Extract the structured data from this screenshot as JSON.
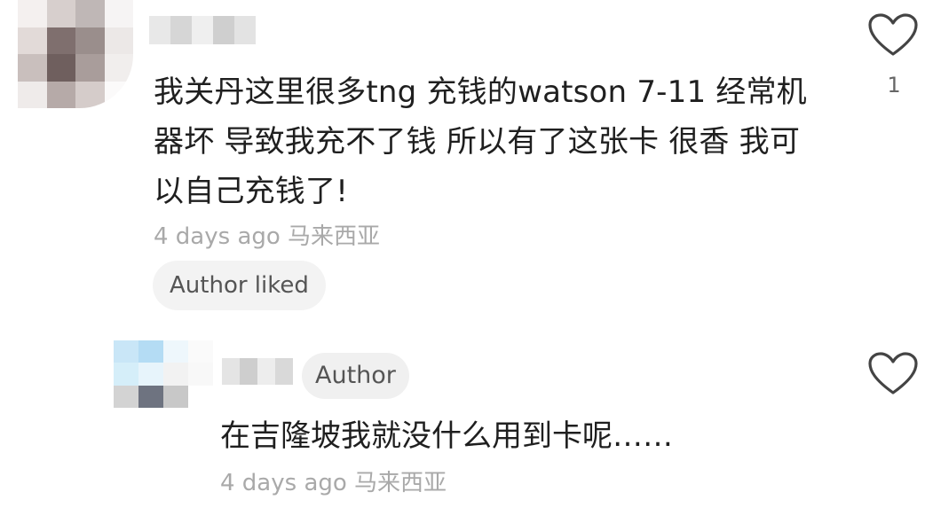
{
  "comment": {
    "text": "我关丹这里很多tng 充钱的watson 7-11 经常机器坏 导致我充不了钱 所以有了这张卡 很香 我可以自己充钱了!",
    "meta": "4 days ago 马来西亚",
    "author_liked_label": "Author liked",
    "like_count": "1",
    "like_icon": "heart-outline-icon",
    "avatar_colors": [
      "#f4f0ef",
      "#d7cfcd",
      "#bfb7b6",
      "#f6f4f4",
      "#e2dad8",
      "#7f6f6e",
      "#9a8e8c",
      "#ece8e7",
      "#c9bfbd",
      "#6f5f5e",
      "#a99d9b",
      "#f1eeed",
      "#efebea",
      "#b6aaa8",
      "#d5ccca",
      "#fbfafa"
    ],
    "name_blur_colors": [
      "#e8e8e8",
      "#d6d6d6",
      "#efefef",
      "#cfcfcf",
      "#e3e3e3"
    ]
  },
  "reply": {
    "author_badge": "Author",
    "text": "在吉隆坡我就没什么用到卡呢……",
    "meta": "4 days ago 马来西亚",
    "like_icon": "heart-outline-icon",
    "avatar_colors": [
      "#ffffff",
      "#c9e6f7",
      "#b4dcf4",
      "#eef7fc",
      "#fafafa",
      "#ffffff",
      "#d5eef9",
      "#e7f4fb",
      "#f2f2f2",
      "#f8f8f8",
      "#ffffff",
      "#d3d3d3",
      "#6e7380",
      "#c8c8c8",
      "#ffffff"
    ],
    "name_blur_colors": [
      "#e4e4e4",
      "#cecece",
      "#ededed",
      "#d9d9d9"
    ]
  },
  "colors": {
    "text_primary": "#1f1f1f",
    "text_meta": "#a9a9a9",
    "pill_bg": "#f3f3f3",
    "icon_stroke": "#444444"
  }
}
